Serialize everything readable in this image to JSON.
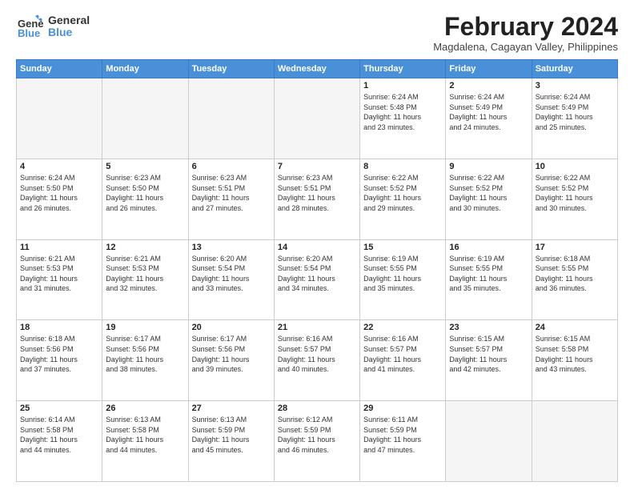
{
  "header": {
    "logo_line1": "General",
    "logo_line2": "Blue",
    "month_year": "February 2024",
    "location": "Magdalena, Cagayan Valley, Philippines"
  },
  "days_of_week": [
    "Sunday",
    "Monday",
    "Tuesday",
    "Wednesday",
    "Thursday",
    "Friday",
    "Saturday"
  ],
  "weeks": [
    [
      {
        "day": "",
        "info": ""
      },
      {
        "day": "",
        "info": ""
      },
      {
        "day": "",
        "info": ""
      },
      {
        "day": "",
        "info": ""
      },
      {
        "day": "1",
        "info": "Sunrise: 6:24 AM\nSunset: 5:48 PM\nDaylight: 11 hours\nand 23 minutes."
      },
      {
        "day": "2",
        "info": "Sunrise: 6:24 AM\nSunset: 5:49 PM\nDaylight: 11 hours\nand 24 minutes."
      },
      {
        "day": "3",
        "info": "Sunrise: 6:24 AM\nSunset: 5:49 PM\nDaylight: 11 hours\nand 25 minutes."
      }
    ],
    [
      {
        "day": "4",
        "info": "Sunrise: 6:24 AM\nSunset: 5:50 PM\nDaylight: 11 hours\nand 26 minutes."
      },
      {
        "day": "5",
        "info": "Sunrise: 6:23 AM\nSunset: 5:50 PM\nDaylight: 11 hours\nand 26 minutes."
      },
      {
        "day": "6",
        "info": "Sunrise: 6:23 AM\nSunset: 5:51 PM\nDaylight: 11 hours\nand 27 minutes."
      },
      {
        "day": "7",
        "info": "Sunrise: 6:23 AM\nSunset: 5:51 PM\nDaylight: 11 hours\nand 28 minutes."
      },
      {
        "day": "8",
        "info": "Sunrise: 6:22 AM\nSunset: 5:52 PM\nDaylight: 11 hours\nand 29 minutes."
      },
      {
        "day": "9",
        "info": "Sunrise: 6:22 AM\nSunset: 5:52 PM\nDaylight: 11 hours\nand 30 minutes."
      },
      {
        "day": "10",
        "info": "Sunrise: 6:22 AM\nSunset: 5:52 PM\nDaylight: 11 hours\nand 30 minutes."
      }
    ],
    [
      {
        "day": "11",
        "info": "Sunrise: 6:21 AM\nSunset: 5:53 PM\nDaylight: 11 hours\nand 31 minutes."
      },
      {
        "day": "12",
        "info": "Sunrise: 6:21 AM\nSunset: 5:53 PM\nDaylight: 11 hours\nand 32 minutes."
      },
      {
        "day": "13",
        "info": "Sunrise: 6:20 AM\nSunset: 5:54 PM\nDaylight: 11 hours\nand 33 minutes."
      },
      {
        "day": "14",
        "info": "Sunrise: 6:20 AM\nSunset: 5:54 PM\nDaylight: 11 hours\nand 34 minutes."
      },
      {
        "day": "15",
        "info": "Sunrise: 6:19 AM\nSunset: 5:55 PM\nDaylight: 11 hours\nand 35 minutes."
      },
      {
        "day": "16",
        "info": "Sunrise: 6:19 AM\nSunset: 5:55 PM\nDaylight: 11 hours\nand 35 minutes."
      },
      {
        "day": "17",
        "info": "Sunrise: 6:18 AM\nSunset: 5:55 PM\nDaylight: 11 hours\nand 36 minutes."
      }
    ],
    [
      {
        "day": "18",
        "info": "Sunrise: 6:18 AM\nSunset: 5:56 PM\nDaylight: 11 hours\nand 37 minutes."
      },
      {
        "day": "19",
        "info": "Sunrise: 6:17 AM\nSunset: 5:56 PM\nDaylight: 11 hours\nand 38 minutes."
      },
      {
        "day": "20",
        "info": "Sunrise: 6:17 AM\nSunset: 5:56 PM\nDaylight: 11 hours\nand 39 minutes."
      },
      {
        "day": "21",
        "info": "Sunrise: 6:16 AM\nSunset: 5:57 PM\nDaylight: 11 hours\nand 40 minutes."
      },
      {
        "day": "22",
        "info": "Sunrise: 6:16 AM\nSunset: 5:57 PM\nDaylight: 11 hours\nand 41 minutes."
      },
      {
        "day": "23",
        "info": "Sunrise: 6:15 AM\nSunset: 5:57 PM\nDaylight: 11 hours\nand 42 minutes."
      },
      {
        "day": "24",
        "info": "Sunrise: 6:15 AM\nSunset: 5:58 PM\nDaylight: 11 hours\nand 43 minutes."
      }
    ],
    [
      {
        "day": "25",
        "info": "Sunrise: 6:14 AM\nSunset: 5:58 PM\nDaylight: 11 hours\nand 44 minutes."
      },
      {
        "day": "26",
        "info": "Sunrise: 6:13 AM\nSunset: 5:58 PM\nDaylight: 11 hours\nand 44 minutes."
      },
      {
        "day": "27",
        "info": "Sunrise: 6:13 AM\nSunset: 5:59 PM\nDaylight: 11 hours\nand 45 minutes."
      },
      {
        "day": "28",
        "info": "Sunrise: 6:12 AM\nSunset: 5:59 PM\nDaylight: 11 hours\nand 46 minutes."
      },
      {
        "day": "29",
        "info": "Sunrise: 6:11 AM\nSunset: 5:59 PM\nDaylight: 11 hours\nand 47 minutes."
      },
      {
        "day": "",
        "info": ""
      },
      {
        "day": "",
        "info": ""
      }
    ]
  ]
}
